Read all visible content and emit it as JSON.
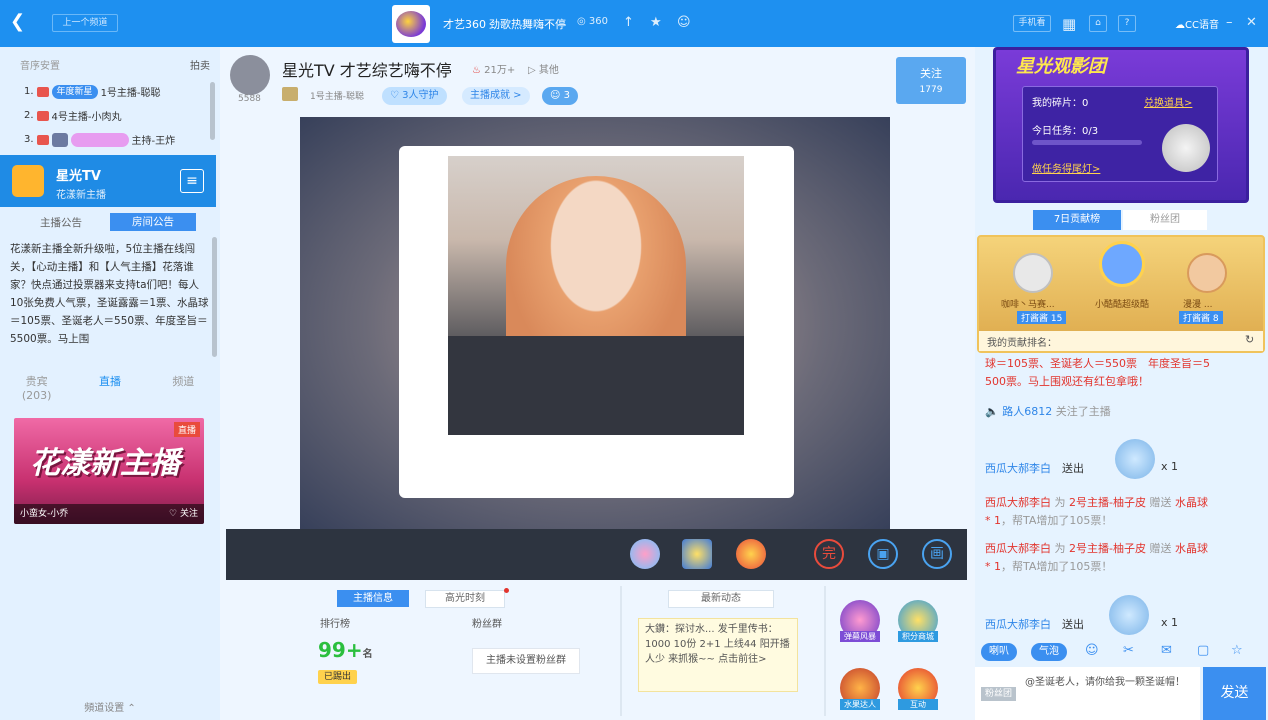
{
  "topbar": {
    "back_icon": "chevron-left-icon",
    "prev_label": "上一个频道",
    "channel_title": "才艺360",
    "channel_subtitle": "劲歌热舞嗨不停",
    "viewers": "360",
    "right_phone_label": "手机看",
    "cc_label": "CC语音"
  },
  "left": {
    "rank_header": "音序安置",
    "rank_tail": "拍卖",
    "ranks": [
      {
        "num": "1.",
        "badge": "年度新星",
        "name": "1号主播-聪聪"
      },
      {
        "num": "2.",
        "badge": "",
        "name": "4号主播-小肉丸"
      },
      {
        "num": "3.",
        "badge": "",
        "name": "主持-王炸"
      }
    ],
    "star_title": "星光TV",
    "star_sub": "花漾新主播",
    "tab_notice": "主播公告",
    "tab_room_notice": "房间公告",
    "notice_text": "花漾新主播全新升级啦，5位主播在线闯关，【心动主播】和【人气主播】花落谁家？快点通过投票器来支持ta们吧！每人10张免费人气票，圣诞露露＝1票、水晶球＝105票、圣诞老人＝550票、年度圣旨＝5500票。马上围",
    "tabs": [
      {
        "label": "贵宾",
        "sub": "(203)"
      },
      {
        "label": "直播",
        "sub": ""
      },
      {
        "label": "频道",
        "sub": ""
      }
    ],
    "banner_title": "花漾新主播",
    "banner_live": "直播",
    "banner_user": "小蛮女-小乔",
    "banner_follow": "关注",
    "bottom_label": "頻道设置"
  },
  "stream": {
    "title": "星光TV 才艺综艺嗨不停",
    "hot": "21万+",
    "play_label": "其他",
    "anchor_id": "5588",
    "host": "1号主播-聪聪",
    "guard": "3人守护",
    "achievement": "主播成就 >",
    "fans": "3",
    "follow_label": "关注",
    "follow_count": "1779"
  },
  "bottom": {
    "tab_info": "主播信息",
    "tab_highlight": "高光时刻",
    "rank_label": "排行榜",
    "rank_value": "99+",
    "rank_unit": "名",
    "fans_label": "粉丝群",
    "fans_button": "主播未设置粉丝群",
    "rank_badge": "已踢出",
    "news_title": "最新动态",
    "news_text": "大鑽：探讨水... 发千里传书：1000 10份 2+1 上线44 阳开播 人少 来抓猴~~ 点击前往>",
    "news_link": "点击前往>",
    "gift_labels": [
      "弹幕风暴",
      "积分商城",
      "水果达人",
      "互动"
    ]
  },
  "right": {
    "movie_title": "星光观影团",
    "shards": "我的碎片：0",
    "exchange": "兑换道具>",
    "task": "今日任务：0/3",
    "task_link": "做任务得尾灯>",
    "tab_contrib": "7日贡献榜",
    "tab_fans": "粉丝团",
    "top3": [
      {
        "name": "咖啡丶马赛...",
        "badge": "打酱酱 15"
      },
      {
        "name": "小酷酷超级酷",
        "badge": ""
      },
      {
        "name": "漫漫 ...",
        "badge": "打酱酱 8"
      }
    ],
    "my_rank": "我的贡献排名：",
    "chat": [
      {
        "type": "red",
        "text": "球＝105票、圣诞老人＝550票　年度圣旨＝5"
      },
      {
        "type": "red",
        "text": "500票。马上围观还有红包拿哦！"
      },
      {
        "type": "sys",
        "user": "路人6812",
        "text": "关注了主播"
      },
      {
        "type": "gift",
        "user": "西瓜大郝李白",
        "text": "送出",
        "count": "x 1"
      },
      {
        "type": "vote",
        "user": "西瓜大郝李白",
        "pre": "为",
        "target": "2号主播-柚子皮",
        "action": "赠送",
        "item": "水晶球",
        "amount": "* 1",
        "result": "，帮TA增加了105票！"
      },
      {
        "type": "vote",
        "user": "西瓜大郝李白",
        "pre": "为",
        "target": "2号主播-柚子皮",
        "action": "赠送",
        "item": "水晶球",
        "amount": "* 1",
        "result": "，帮TA增加了105票！"
      },
      {
        "type": "gift",
        "user": "西瓜大郝李白",
        "text": "送出",
        "count": "x 1"
      }
    ],
    "tool_label1": "喇叭",
    "tool_label2": "气泡",
    "fans_group": "粉丝团",
    "input_mention": "@圣诞老人，请你给我一颗圣诞帽！",
    "send_label": "发送"
  },
  "colors": {
    "brand": "#1e90f0",
    "red": "#e2342d",
    "blue": "#2f86e8"
  }
}
